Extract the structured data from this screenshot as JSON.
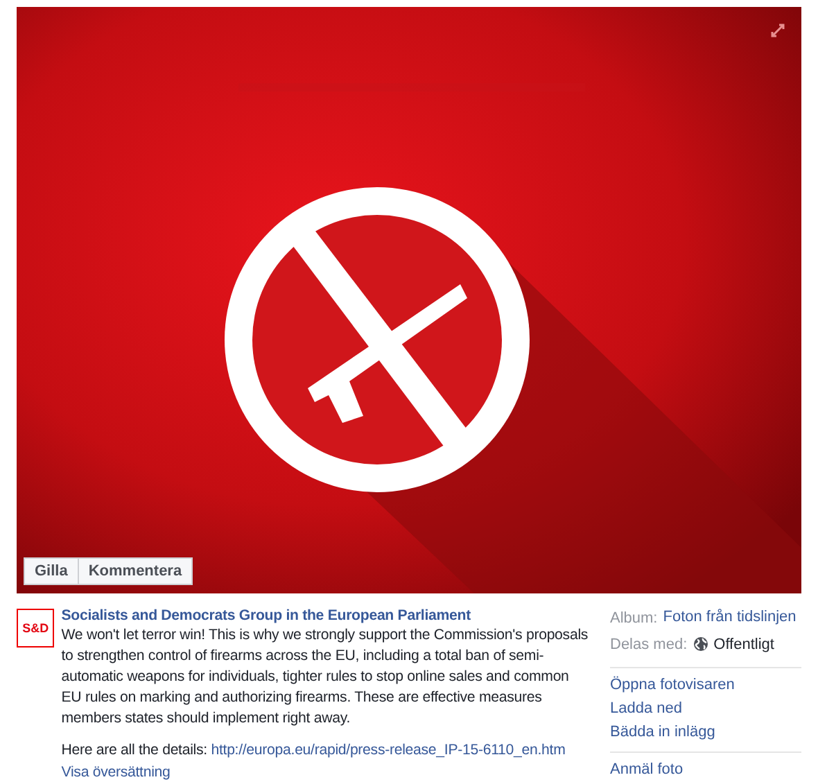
{
  "photo": {
    "kind": "picture",
    "actions": [
      {
        "label": "Gilla"
      },
      {
        "label": "Kommentera"
      }
    ]
  },
  "post": {
    "avatar_text": "S&D",
    "author": "Socialists and Democrats Group in the European Parliament",
    "body": "We won't let terror win! This is why we strongly support the Commission's proposals to strengthen control of firearms across the EU, including a total ban of semi-automatic weapons for individuals, tighter rules to stop online sales and common EU rules on marking and authorizing firearms. These are effective measures members states should implement right away.",
    "details_label": "Here are all the details:",
    "details_link": "http://europa.eu/rapid/press-release_IP-15-6110_en.htm",
    "translate": "Visa översättning"
  },
  "sidebar": {
    "album_label": "Album:",
    "album": "Foton från tidslinjen",
    "shared_label": "Delas med:",
    "shared": "Offentligt",
    "actions": [
      "Öppna fotovisaren",
      "Ladda ned",
      "Bädda in inlägg"
    ],
    "report": "Anmäl foto"
  }
}
